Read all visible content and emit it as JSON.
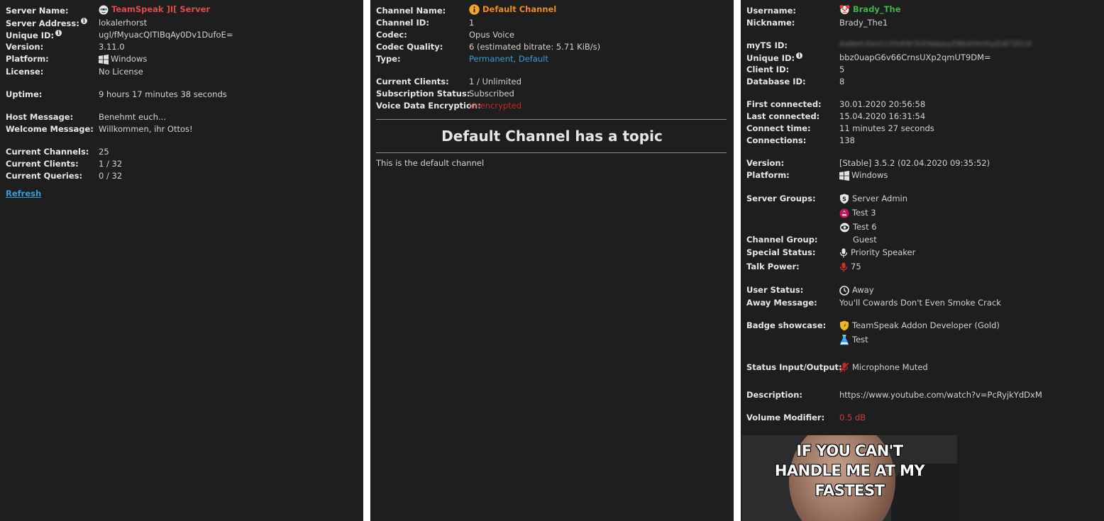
{
  "server": {
    "name_label": "Server Name:",
    "name_value": "TeamSpeak ]I[ Server",
    "address_label": "Server Address:",
    "address_value": "lokalerhorst",
    "uid_label": "Unique ID:",
    "uid_value": "ugl/fMyuacQITIBqAy0Dv1DufoE=",
    "version_label": "Version:",
    "version_value": "3.11.0",
    "platform_label": "Platform:",
    "platform_value": "Windows",
    "license_label": "License:",
    "license_value": "No License",
    "uptime_label": "Uptime:",
    "uptime_value": "9 hours 17 minutes 38 seconds",
    "host_msg_label": "Host Message:",
    "host_msg_value": "Benehmt euch...",
    "welcome_label": "Welcome Message:",
    "welcome_value": "Willkommen, ihr Ottos!",
    "channels_label": "Current Channels:",
    "channels_value": "25",
    "clients_label": "Current Clients:",
    "clients_value": "1 / 32",
    "queries_label": "Current Queries:",
    "queries_value": "0 / 32",
    "refresh_label": "Refresh"
  },
  "channel": {
    "name_label": "Channel Name:",
    "name_value": "Default Channel",
    "id_label": "Channel ID:",
    "id_value": "1",
    "codec_label": "Codec:",
    "codec_value": "Opus Voice",
    "quality_label": "Codec Quality:",
    "quality_value": "6 (estimated bitrate: 5.71 KiB/s)",
    "type_label": "Type:",
    "type_value": "Permanent, Default",
    "clients_label": "Current Clients:",
    "clients_value": "1 / Unlimited",
    "sub_label": "Subscription Status:",
    "sub_value": "Subscribed",
    "enc_label": "Voice Data Encryption:",
    "enc_value": "Unencrypted",
    "topic_title": "Default Channel has a topic",
    "topic_body": "This is the default channel"
  },
  "client": {
    "username_label": "Username:",
    "username_value": "Brady_The",
    "nickname_label": "Nickname:",
    "nickname_value": "Brady_The1",
    "myts_label": "myTS ID:",
    "myts_value": "AaNeh3IeiCc2feK9r3iXYabjeyZNkAtHnhyZzE7ZC/X",
    "uid_label": "Unique ID:",
    "uid_value": "bbz0uapG6v66CrnsUXp2qmUT9DM=",
    "clientid_label": "Client ID:",
    "clientid_value": "5",
    "dbid_label": "Database ID:",
    "dbid_value": "8",
    "first_label": "First connected:",
    "first_value": "30.01.2020 20:56:58",
    "last_label": "Last connected:",
    "last_value": "15.04.2020 16:31:54",
    "ctime_label": "Connect time:",
    "ctime_value": "11 minutes 27 seconds",
    "conns_label": "Connections:",
    "conns_value": "138",
    "version_label": "Version:",
    "version_value": "[Stable] 3.5.2 (02.04.2020 09:35:52)",
    "platform_label": "Platform:",
    "platform_value": "Windows",
    "sgroups_label": "Server Groups:",
    "sgroups": [
      "Server Admin",
      "Test 3",
      "Test 6"
    ],
    "cgroup_label": "Channel Group:",
    "cgroup_value": "Guest",
    "special_label": "Special Status:",
    "special_value": "Priority Speaker",
    "talk_label": "Talk Power:",
    "talk_value": "75",
    "ustatus_label": "User Status:",
    "ustatus_value": "Away",
    "away_label": "Away Message:",
    "away_value": "You'll Cowards Don't Even Smoke Crack",
    "badge_label": "Badge showcase:",
    "badges": [
      "TeamSpeak Addon Developer (Gold)",
      "Test"
    ],
    "io_label": "Status Input/Output:",
    "io_value": "Microphone Muted",
    "desc_label": "Description:",
    "desc_value": "https://www.youtube.com/watch?v=PcRyjkYdDxM",
    "vol_label": "Volume Modifier:",
    "vol_value": "0.5 dB",
    "meme_lines": [
      "IF YOU CAN'T",
      "HANDLE ME AT MY",
      "FASTEST"
    ]
  },
  "colors": {
    "panel_bg": "#1e1e1e",
    "label": "#e6e6e6",
    "value": "#d2d2d2",
    "server_name": "#e34b4b",
    "channel_name": "#f08c12",
    "username": "#3fb44f",
    "link": "#3a9cd6",
    "danger": "#d43c3c"
  }
}
